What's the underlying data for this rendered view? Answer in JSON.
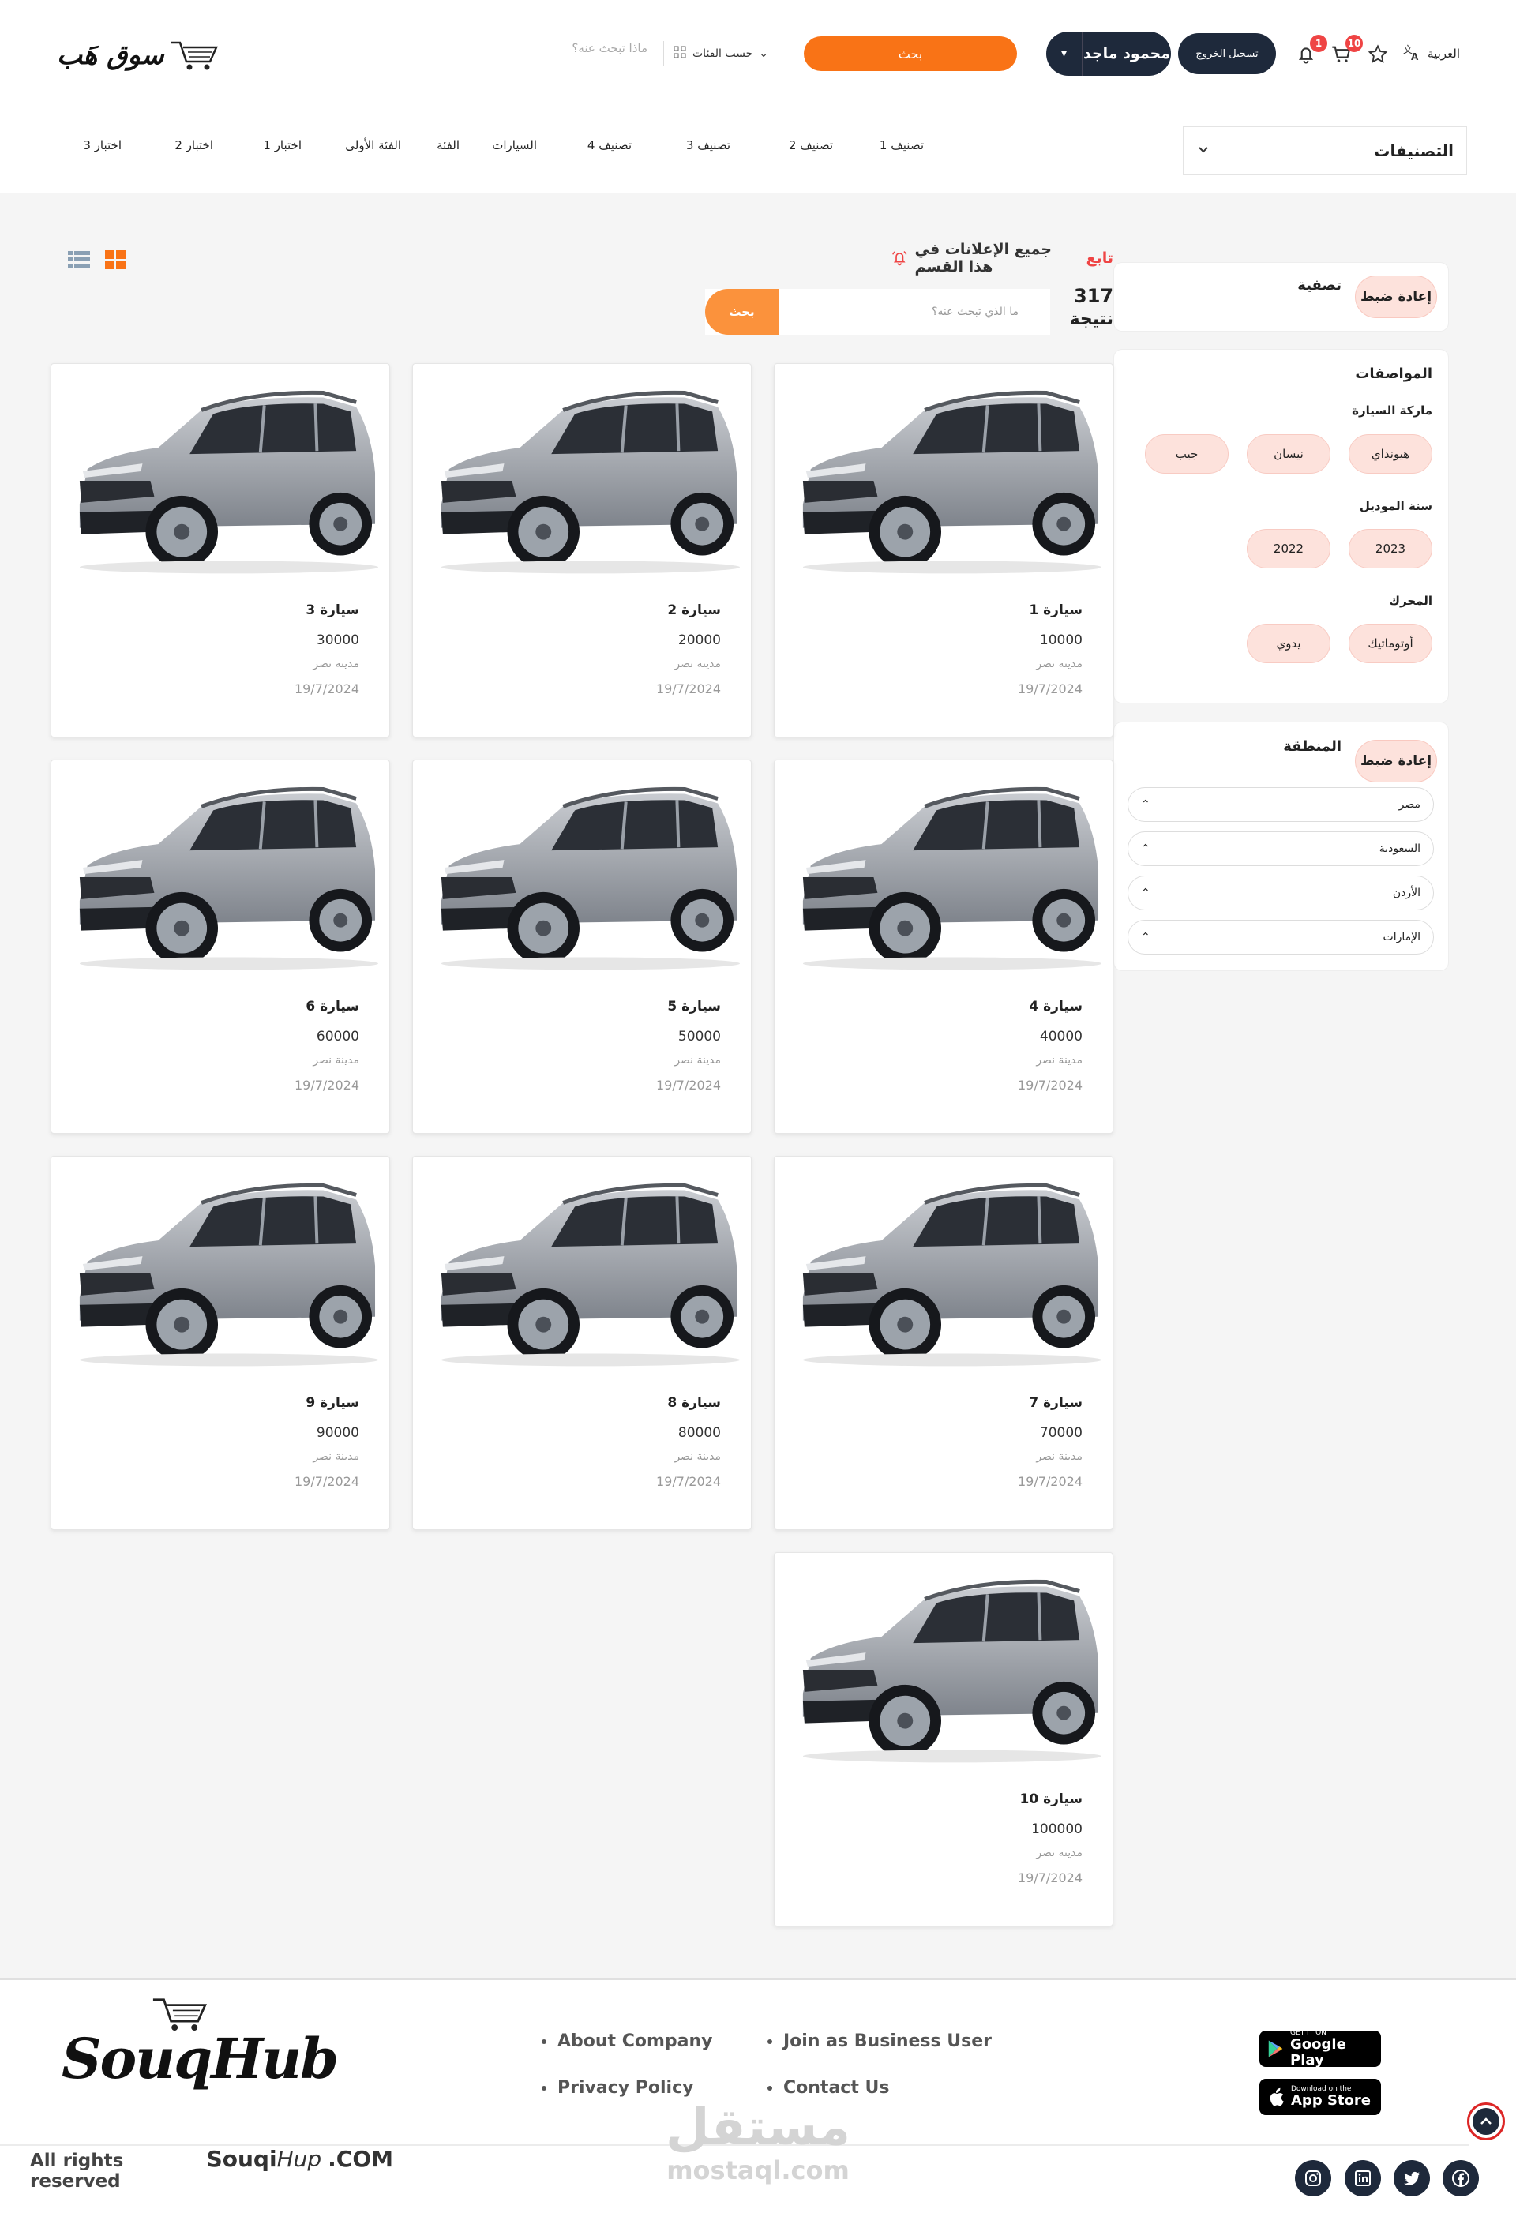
{
  "header": {
    "logo_text": "سوق هَب",
    "search_placeholder": "ماذا تبحث عنه؟",
    "category_select": "حسب الفئات",
    "search_button": "بحث",
    "user_name": "محمود ماجد",
    "logout": "تسجيل الخروج",
    "cart_badge": "10",
    "notif_badge": "1",
    "language": "العربية"
  },
  "nav": {
    "categories_dropdown": "التصنيفات",
    "items": [
      "تصنيف 1",
      "تصنيف 2",
      "تصنيف 3",
      "تصنيف 4",
      "السيارات",
      "الفئة",
      "الفئة الأولى",
      "اختبار 1",
      "اختبار 2",
      "اختبار 3"
    ]
  },
  "toolbar": {
    "follow_prefix": "تابع",
    "follow_text": "جميع الإعلانات في هذا القسم",
    "results_count": "317",
    "results_label": "نتيجة",
    "search_placeholder": "ما الذي تبحث عنه؟",
    "search_button": "بحث"
  },
  "filter": {
    "title": "تصفية",
    "reset": "إعادة ضبط"
  },
  "specs": {
    "title": "المواصفات",
    "brand_label": "ماركة السيارة",
    "brands": [
      "هيونداي",
      "نيسان",
      "جيب"
    ],
    "year_label": "سنة الموديل",
    "years": [
      "2023",
      "2022"
    ],
    "engine_label": "المحرك",
    "engines": [
      "أوتوماتيك",
      "يدوي"
    ]
  },
  "region": {
    "title": "المنطقة",
    "reset": "إعادة ضبط",
    "items": [
      "مصر",
      "السعودية",
      "الأردن",
      "الإمارات"
    ]
  },
  "listings": [
    {
      "title": "سيارة 1",
      "price": "10000",
      "location": "مدينة نصر",
      "date": "19/7/2024"
    },
    {
      "title": "سيارة 2",
      "price": "20000",
      "location": "مدينة نصر",
      "date": "19/7/2024"
    },
    {
      "title": "سيارة 3",
      "price": "30000",
      "location": "مدينة نصر",
      "date": "19/7/2024"
    },
    {
      "title": "سيارة 4",
      "price": "40000",
      "location": "مدينة نصر",
      "date": "19/7/2024"
    },
    {
      "title": "سيارة 5",
      "price": "50000",
      "location": "مدينة نصر",
      "date": "19/7/2024"
    },
    {
      "title": "سيارة 6",
      "price": "60000",
      "location": "مدينة نصر",
      "date": "19/7/2024"
    },
    {
      "title": "سيارة 7",
      "price": "70000",
      "location": "مدينة نصر",
      "date": "19/7/2024"
    },
    {
      "title": "سيارة 8",
      "price": "80000",
      "location": "مدينة نصر",
      "date": "19/7/2024"
    },
    {
      "title": "سيارة 9",
      "price": "90000",
      "location": "مدينة نصر",
      "date": "19/7/2024"
    },
    {
      "title": "سيارة 10",
      "price": "100000",
      "location": "مدينة نصر",
      "date": "19/7/2024"
    }
  ],
  "footer": {
    "logo_text": "SouqHub",
    "links": [
      "About Company",
      "Privacy Policy",
      "Join as Business User",
      "Contact Us"
    ],
    "google_play_small": "GET IT ON",
    "google_play": "Google Play",
    "app_store_small": "Download on the",
    "app_store": "App Store",
    "copyright_prefix": "All rights reserved",
    "copyright_brand": "Souqi",
    "copyright_brand_italic": "Hup",
    "copyright_suffix": ".COM",
    "watermark_ar": "مستقل",
    "watermark_en": "mostaql.com"
  },
  "colors": {
    "accent": "#f97316",
    "dark": "#1e293b",
    "chip": "#fde2dc",
    "alert": "#ef4444"
  }
}
